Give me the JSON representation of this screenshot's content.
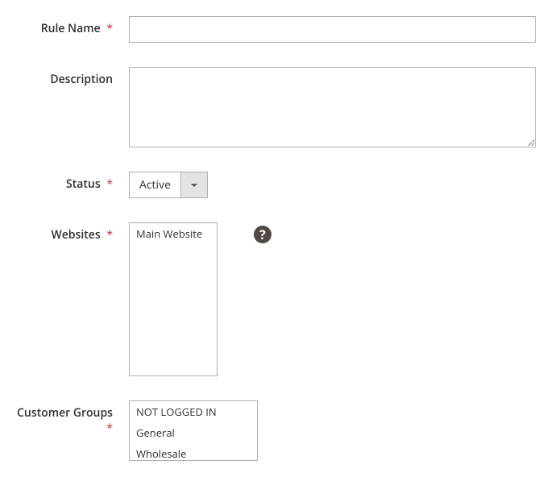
{
  "fields": {
    "rule_name": {
      "label": "Rule Name",
      "required": true,
      "value": ""
    },
    "description": {
      "label": "Description",
      "required": false,
      "value": ""
    },
    "status": {
      "label": "Status",
      "required": true,
      "selected": "Active"
    },
    "websites": {
      "label": "Websites",
      "required": true,
      "options": [
        "Main Website"
      ]
    },
    "customer_groups": {
      "label": "Customer Groups",
      "required": true,
      "options": [
        "NOT LOGGED IN",
        "General",
        "Wholesale"
      ]
    }
  },
  "required_marker": "*",
  "help_icon": "?"
}
